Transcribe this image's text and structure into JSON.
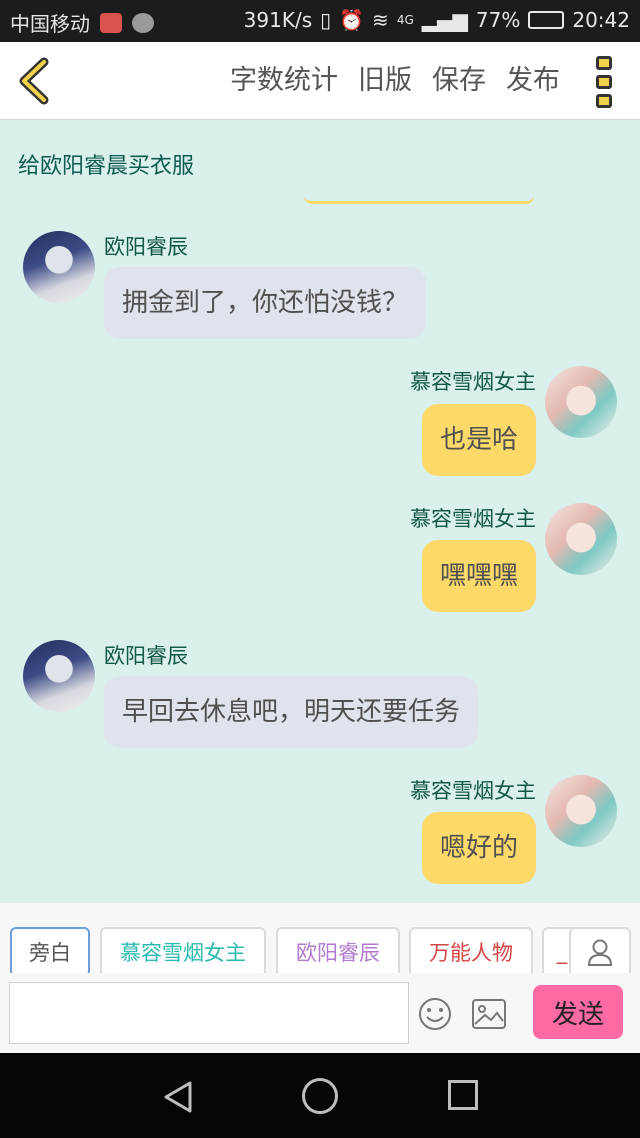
{
  "status_bar": {
    "carrier": "中国移动",
    "net_speed": "391K/s",
    "network_type": "4G",
    "battery": "77%",
    "battery_level": 0.77,
    "time": "20:42"
  },
  "toolbar": {
    "word_count": "字数统计",
    "old_version": "旧版",
    "save": "保存",
    "publish": "发布"
  },
  "story": {
    "title": "给欧阳睿晨买衣服"
  },
  "messages": [
    {
      "side": "left",
      "sender": "欧阳睿辰",
      "text": "拥金到了，你还怕没钱？"
    },
    {
      "side": "right",
      "sender": "慕容雪烟女主",
      "text": "也是哈"
    },
    {
      "side": "right",
      "sender": "慕容雪烟女主",
      "text": "嘿嘿嘿"
    },
    {
      "side": "left",
      "sender": "欧阳睿辰",
      "text": "早回去休息吧，明天还要任务"
    },
    {
      "side": "right",
      "sender": "慕容雪烟女主",
      "text": "嗯好的"
    }
  ],
  "roles": {
    "narrator": "旁白",
    "role1": "慕容雪烟女主",
    "role2": "欧阳睿辰",
    "role3": "万能人物",
    "role4": "_"
  },
  "composer": {
    "input_value": "",
    "send": "发送"
  },
  "colors": {
    "chat_bg": "#daf0ed",
    "bubble_left": "#dfe4ec",
    "bubble_right": "#fdd96a",
    "send_button": "#ff6aa3",
    "name_text": "#135749"
  }
}
